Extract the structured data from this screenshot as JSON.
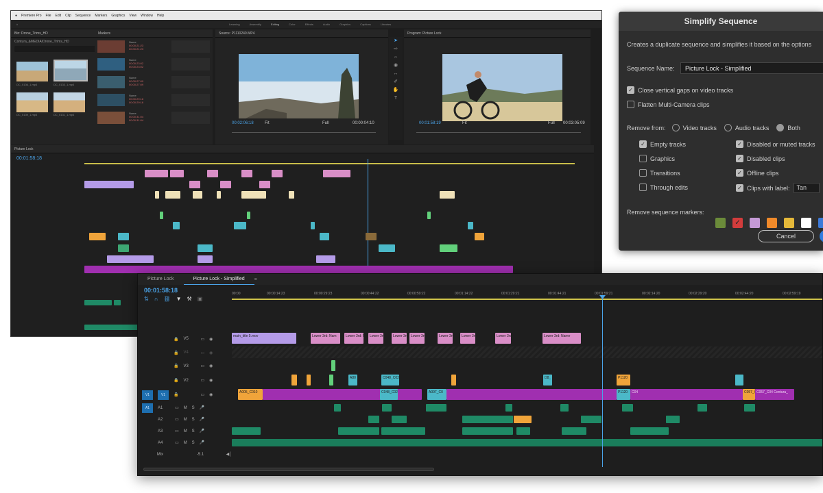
{
  "mac_menu": [
    "Premiere Pro",
    "File",
    "Edit",
    "Clip",
    "Sequence",
    "Markers",
    "Graphics",
    "View",
    "Window",
    "Help"
  ],
  "workspace_tabs": [
    "Learning",
    "Assembly",
    "Editing",
    "Color",
    "Effects",
    "Audio",
    "Graphics",
    "Captions",
    "Libraries"
  ],
  "bin": {
    "title": "Bin: Drone_Trims_HD",
    "path": "Contura_&MEDIA/Drone_Trims_HD",
    "clips": [
      "DC_0136_1.mp4",
      "DC_0133_1.mp4",
      "DC_0139_1.mp4",
      "DC_0131_1.mp4"
    ]
  },
  "markers": {
    "title": "Markers",
    "rows": [
      {
        "name": "Name",
        "in": "00:00:21:23",
        "out": "00:00:21:23"
      },
      {
        "name": "Name",
        "in": "00:00:23:02",
        "out": "00:00:23:02"
      },
      {
        "name": "Name",
        "in": "00:00:27:09",
        "out": "00:00:27:09"
      },
      {
        "name": "Name",
        "in": "00:00:29:16",
        "out": "00:00:29:16"
      },
      {
        "name": "Name",
        "in": "00:00:31:04",
        "out": "00:00:31:04"
      }
    ]
  },
  "source": {
    "title": "Source: P1110240.MP4",
    "tc_left": "00:02:06:18",
    "tc_right": "00:00:04:10",
    "fit": "Fit",
    "res": "Full"
  },
  "program": {
    "title": "Program: Picture Lock",
    "tc_left": "00:01:58:19",
    "tc_right": "00:03:05:09",
    "fit": "Fit",
    "res": "Full"
  },
  "back_timeline": {
    "tab": "Picture Lock",
    "timecode": "00:01:58:18"
  },
  "front_timeline": {
    "tabs": [
      "Picture Lock",
      "Picture Lock - Simplified"
    ],
    "timecode": "00:01:58:18",
    "ruler": [
      "00:00",
      "00:00:14:23",
      "00:00:29:23",
      "00:00:44:22",
      "00:00:59:22",
      "00:01:14:22",
      "00:01:29:21",
      "00:01:44:21",
      "00:01:59:21",
      "00:02:14:20",
      "00:02:29:20",
      "00:02:44:20",
      "00:02:59:19"
    ],
    "tracks": {
      "v5": "V5",
      "v4": "V4",
      "v3": "V3",
      "v2": "V2",
      "v1": "V1",
      "a1": "A1",
      "a2": "A2",
      "a3": "A3",
      "a4": "A4",
      "mix": "Mix",
      "src_v": "V1",
      "src_a": "A1",
      "mix_value": "-5.1"
    },
    "clips": {
      "main_title": "main_title 5.mov",
      "lower": "Lower 3rd: Nam",
      "lower2": "Lower 3rd: Name",
      "a805": "A80",
      "c048": "C048_C02",
      "d8": "D8_",
      "p1120": "P1120",
      "a005": "A005_C010",
      "a007": "A007_C0",
      "c057": "C057_C04",
      "c1a": "C04",
      "c2a": "C057_C04 Contura_"
    }
  },
  "dialog": {
    "title": "Simplify Sequence",
    "description": "Creates a duplicate sequence and simplifies it based on the options",
    "seq_label": "Sequence Name:",
    "seq_value": "Picture Lock - Simplified",
    "close_gaps": "Close vertical gaps on video tracks",
    "flatten": "Flatten Multi-Camera clips",
    "remove_from": "Remove from:",
    "r_video": "Video tracks",
    "r_audio": "Audio tracks",
    "r_both": "Both",
    "left_opts": [
      "Empty tracks",
      "Graphics",
      "Transitions",
      "Through edits"
    ],
    "right_opts": [
      "Disabled or muted tracks",
      "Disabled clips",
      "Offline clips",
      "Clips with label:"
    ],
    "label_value": "Tan",
    "markers_label": "Remove sequence markers:",
    "swatches": [
      "#6b8b3a",
      "#d23c3c",
      "#c59ad6",
      "#f08a2a",
      "#e5b93a",
      "#ffffff",
      "#3d7ad8"
    ],
    "cancel": "Cancel"
  }
}
